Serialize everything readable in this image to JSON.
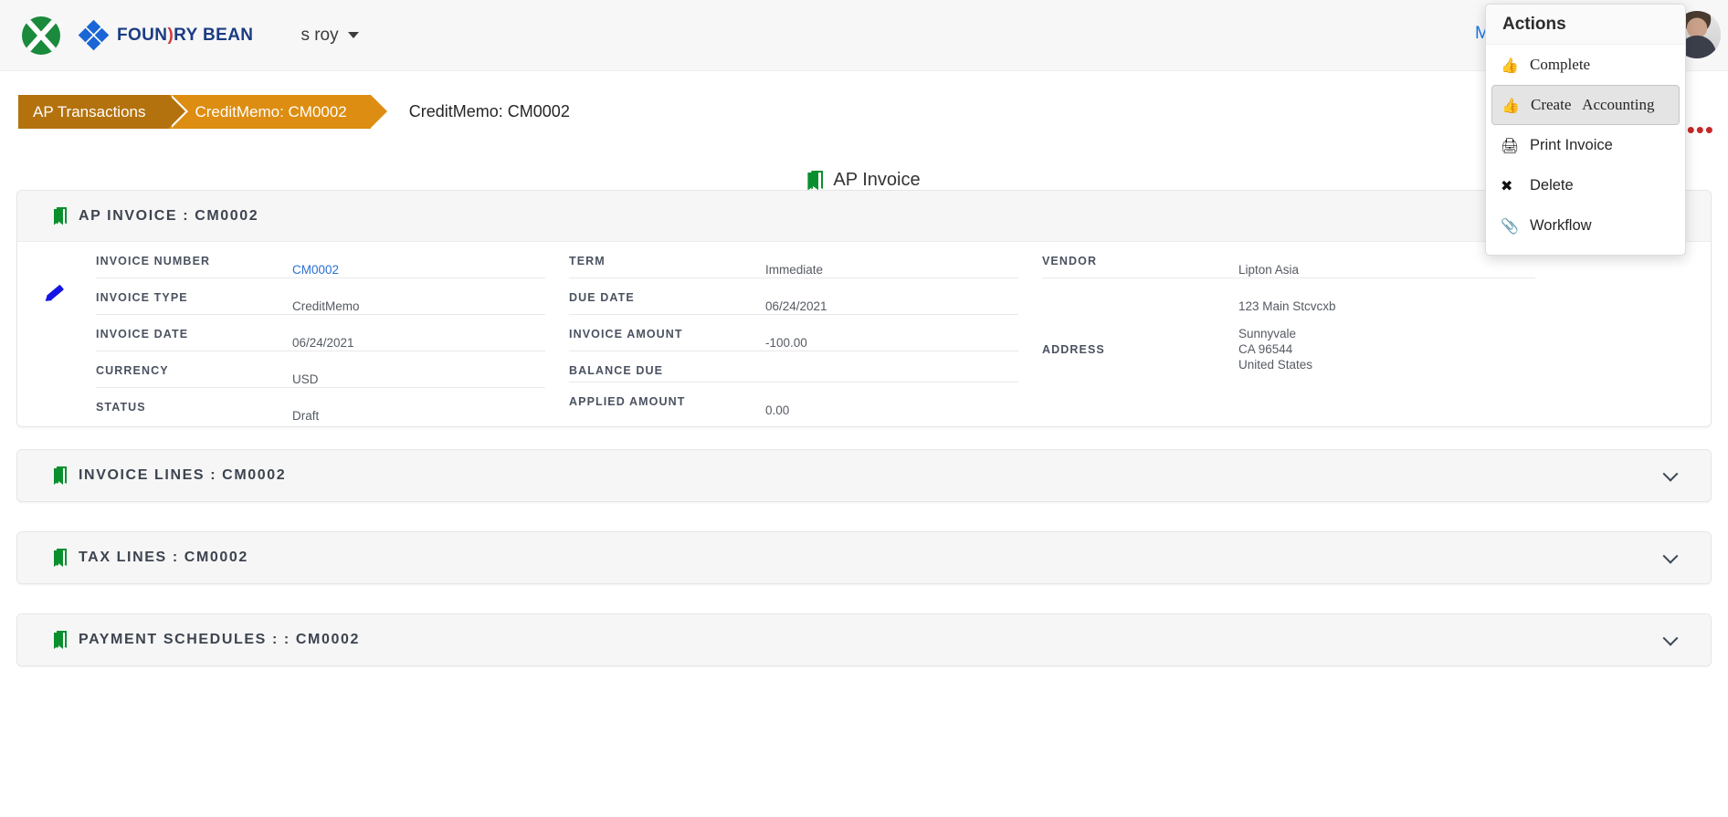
{
  "header": {
    "brand_name_part1": "FOUN",
    "brand_name_red": ")",
    "brand_name_part2": "RY BEAN",
    "logo_icon": "xbox-green-circle-logo",
    "diamond_icon": "diamond-cluster-icon",
    "user_label": "s roy",
    "user_caret_icon": "chevron-down-icon",
    "menu_link": "Men",
    "avatar_icon": "user-avatar-photo"
  },
  "breadcrumb": {
    "items": [
      {
        "label": "AP Transactions"
      },
      {
        "label": "CreditMemo: CM0002"
      }
    ],
    "current": "CreditMemo: CM0002"
  },
  "page_tab": {
    "icon": "bookmark-icon",
    "label": "AP Invoice"
  },
  "toolbar": {
    "more_icon": "ellipsis-icon",
    "next_icon": "chevron-right-icon"
  },
  "actions_menu": {
    "title": "Actions",
    "items": [
      {
        "label": "Complete",
        "icon": "thumbs-up-icon",
        "selected": false
      },
      {
        "label": "Create   Accounting",
        "icon": "thumbs-up-icon",
        "selected": true
      },
      {
        "label": "Print Invoice",
        "icon": "printer-icon",
        "selected": false
      },
      {
        "label": "Delete",
        "icon": "close-x-icon",
        "selected": false
      },
      {
        "label": "Workflow",
        "icon": "paperclip-icon",
        "selected": false
      }
    ]
  },
  "main_card": {
    "icon": "bookmark-icon",
    "title": "AP INVOICE : CM0002",
    "edit_icon": "pencil-icon",
    "col1": [
      {
        "key": "INVOICE NUMBER",
        "value": "CM0002",
        "is_link": true
      },
      {
        "key": "INVOICE TYPE",
        "value": "CreditMemo",
        "is_link": false
      },
      {
        "key": "INVOICE DATE",
        "value": "06/24/2021",
        "is_link": false
      },
      {
        "key": "CURRENCY",
        "value": "USD",
        "is_link": false
      },
      {
        "key": "STATUS",
        "value": "Draft",
        "is_link": false
      }
    ],
    "col2": [
      {
        "key": "TERM",
        "value": "Immediate"
      },
      {
        "key": "DUE DATE",
        "value": "06/24/2021"
      },
      {
        "key": "INVOICE AMOUNT",
        "value": "-100.00"
      },
      {
        "key": "BALANCE DUE",
        "value": ""
      },
      {
        "key": "APPLIED AMOUNT",
        "value": "0.00"
      }
    ],
    "col3": [
      {
        "key": "VENDOR",
        "value": "Lipton Asia"
      },
      {
        "key": "",
        "value": "123 Main Stcvcxb"
      },
      {
        "key": "ADDRESS",
        "value": "Sunnyvale\nCA 96544\nUnited States"
      }
    ]
  },
  "sections": [
    {
      "icon": "bookmark-icon",
      "title": "INVOICE LINES : CM0002",
      "chevron": "chevron-down-icon"
    },
    {
      "icon": "bookmark-icon",
      "title": "TAX LINES : CM0002",
      "chevron": "chevron-down-icon"
    },
    {
      "icon": "bookmark-icon",
      "title": "PAYMENT SCHEDULES : : CM0002",
      "chevron": "chevron-down-icon"
    }
  ],
  "colors": {
    "breadcrumb_active": "#b3720d",
    "breadcrumb_current": "#dd8d11",
    "link": "#2a6fd4",
    "accent_green": "#0a8f2e",
    "more_red": "#c62828"
  }
}
